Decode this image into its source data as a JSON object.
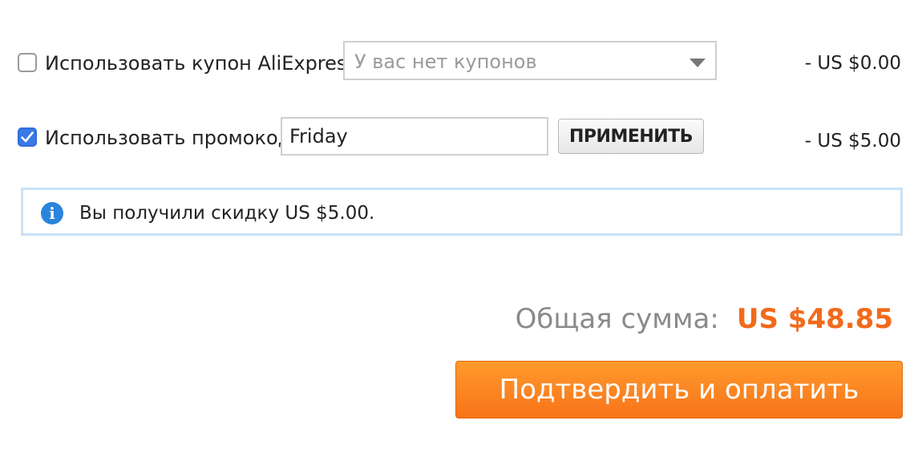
{
  "coupon": {
    "checked": false,
    "label": "Использовать купон AliExpress:",
    "select_value": "У вас нет купонов",
    "amount": "- US $0.00"
  },
  "promo": {
    "checked": true,
    "label": "Использовать промокод",
    "input_value": "Friday",
    "apply_label": "ПРИМЕНИТЬ",
    "amount": "- US $5.00"
  },
  "info": {
    "icon": "info-icon",
    "message": "Вы получили скидку US $5.00."
  },
  "total": {
    "label": "Общая сумма:",
    "value": "US $48.85"
  },
  "pay_button_label": "Подтвердить и оплатить",
  "colors": {
    "accent": "#f26a1b",
    "checkbox_checked": "#3a78e6",
    "info_border": "#c9e2f6",
    "info_icon": "#2a84dd"
  }
}
